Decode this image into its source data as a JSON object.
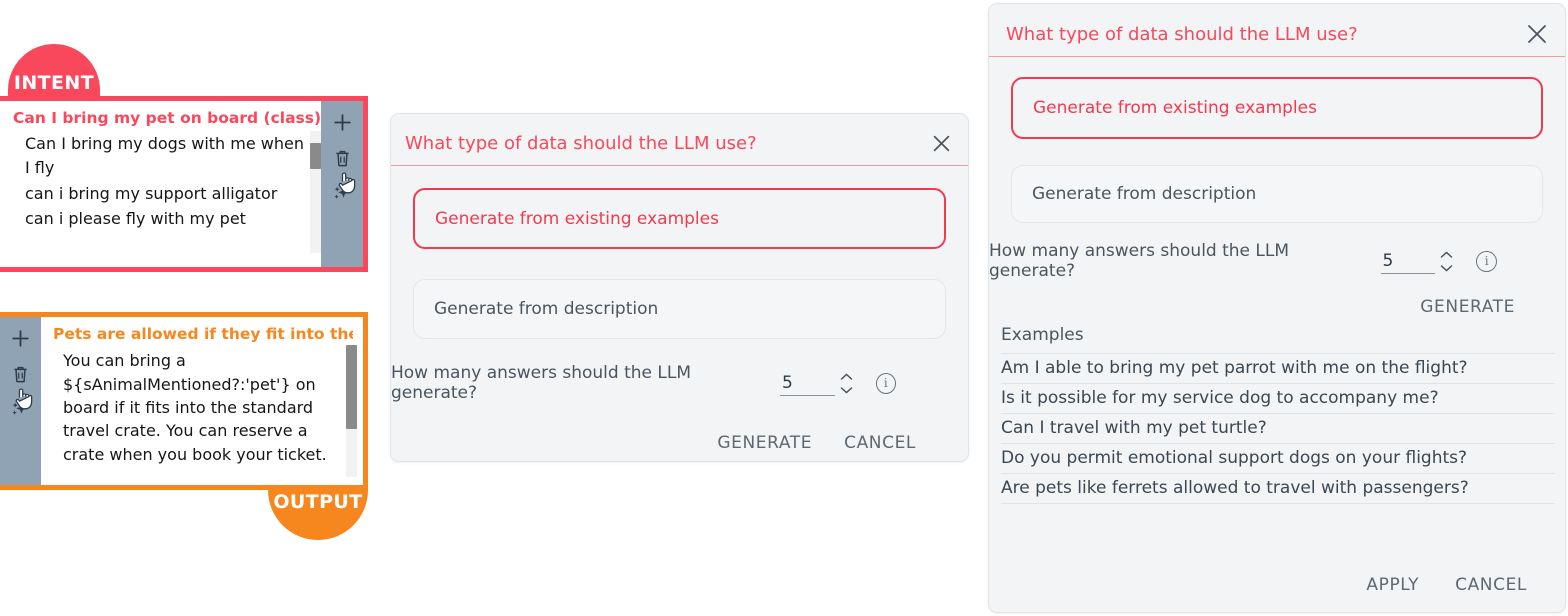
{
  "intent_card": {
    "badge": "INTENT",
    "title": "Can I bring my pet on board (class)",
    "phrases": [
      "Can I bring my dogs with me when I fly",
      "can i bring my support alligator",
      "can i please fly with my pet"
    ],
    "toolbar": [
      "plus-icon",
      "trash-icon",
      "sparkle-icon"
    ],
    "accent_color": "#f9485b"
  },
  "output_card": {
    "badge": "OUTPUT",
    "title": "Pets are allowed if they fit into the …",
    "body": "You can bring a ${sAnimalMentioned?:'pet'} on board if it fits into the standard travel crate. You can reserve a crate when you book your ticket.",
    "toolbar": [
      "plus-icon",
      "trash-icon",
      "sparkle-icon"
    ],
    "accent_color": "#f6871f"
  },
  "center_dialog": {
    "title": "What type of data should the LLM use?",
    "close_icon": "close-icon",
    "option_selected": "Generate from existing examples",
    "option_other": "Generate from description",
    "count_question": "How many answers should the LLM generate?",
    "count_value": "5",
    "info_icon": "info-icon",
    "generate_label": "GENERATE",
    "cancel_label": "CANCEL",
    "accent_color": "#f4394f"
  },
  "right_panel": {
    "title": "What type of data should the LLM use?",
    "close_icon": "close-icon",
    "option_selected": "Generate from existing examples",
    "option_other": "Generate from description",
    "count_question": "How many answers should the LLM generate?",
    "count_value": "5",
    "info_icon": "info-icon",
    "generate_label": "GENERATE",
    "examples_label": "Examples",
    "examples": [
      "Am I able to bring my pet parrot with me on the flight?",
      "Is it possible for my service dog to accompany me?",
      "Can I travel with my pet turtle?",
      "Do you permit emotional support dogs on your flights?",
      "Are pets like ferrets allowed to travel with passengers?"
    ],
    "apply_label": "APPLY",
    "cancel_label": "CANCEL",
    "accent_color": "#f4394f"
  }
}
